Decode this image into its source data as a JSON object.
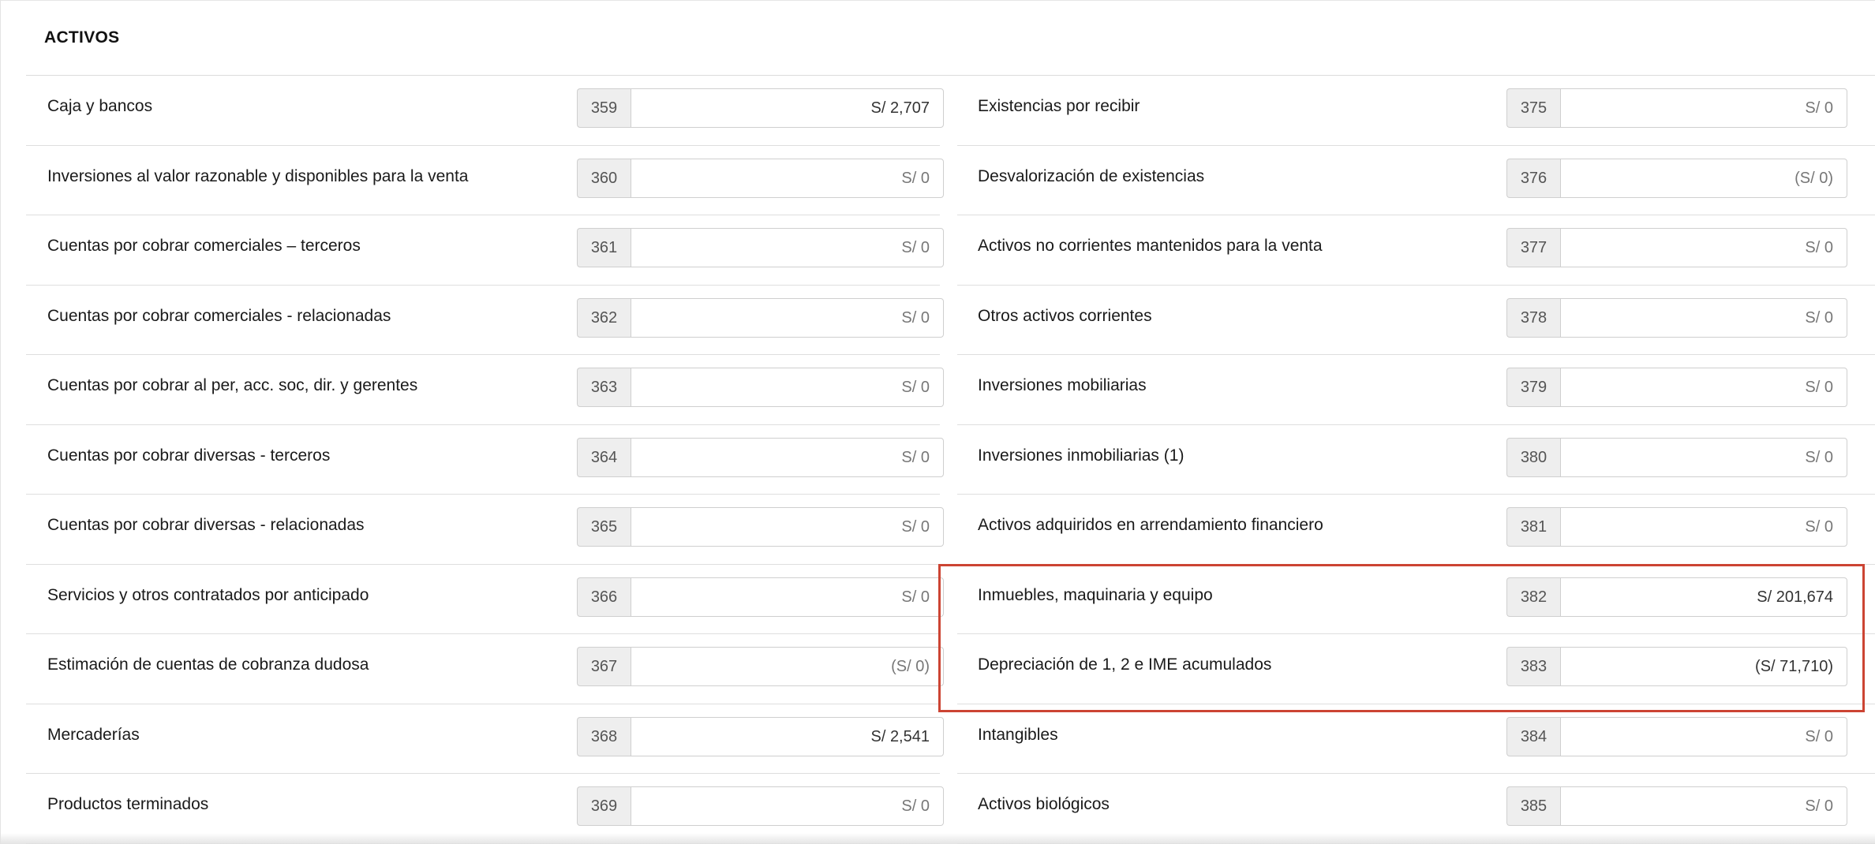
{
  "section": {
    "title": "ACTIVOS"
  },
  "left_rows": [
    {
      "label": "Caja y bancos",
      "code": "359",
      "value": "S/ 2,707"
    },
    {
      "label": "Inversiones al valor razonable y disponibles para la venta",
      "code": "360",
      "value": "S/ 0"
    },
    {
      "label": "Cuentas por cobrar comerciales – terceros",
      "code": "361",
      "value": "S/ 0"
    },
    {
      "label": "Cuentas por cobrar comerciales - relacionadas",
      "code": "362",
      "value": "S/ 0"
    },
    {
      "label": "Cuentas por cobrar al per, acc. soc, dir. y gerentes",
      "code": "363",
      "value": "S/ 0"
    },
    {
      "label": "Cuentas por cobrar diversas - terceros",
      "code": "364",
      "value": "S/ 0"
    },
    {
      "label": "Cuentas por cobrar diversas - relacionadas",
      "code": "365",
      "value": "S/ 0"
    },
    {
      "label": "Servicios y otros contratados por anticipado",
      "code": "366",
      "value": "S/ 0"
    },
    {
      "label": "Estimación de cuentas de cobranza dudosa",
      "code": "367",
      "value": "(S/ 0)"
    },
    {
      "label": "Mercaderías",
      "code": "368",
      "value": "S/ 2,541"
    },
    {
      "label": "Productos terminados",
      "code": "369",
      "value": "S/ 0"
    }
  ],
  "right_rows": [
    {
      "label": "Existencias por recibir",
      "code": "375",
      "value": "S/ 0"
    },
    {
      "label": "Desvalorización de existencias",
      "code": "376",
      "value": "(S/ 0)"
    },
    {
      "label": "Activos no corrientes mantenidos para la venta",
      "code": "377",
      "value": "S/ 0"
    },
    {
      "label": "Otros activos corrientes",
      "code": "378",
      "value": "S/ 0"
    },
    {
      "label": "Inversiones mobiliarias",
      "code": "379",
      "value": "S/ 0"
    },
    {
      "label": "Inversiones inmobiliarias (1)",
      "code": "380",
      "value": "S/ 0"
    },
    {
      "label": "Activos adquiridos en arrendamiento financiero",
      "code": "381",
      "value": "S/ 0"
    },
    {
      "label": "Inmuebles, maquinaria y equipo",
      "code": "382",
      "value": "S/ 201,674"
    },
    {
      "label": "Depreciación de 1, 2 e IME acumulados",
      "code": "383",
      "value": "(S/ 71,710)"
    },
    {
      "label": "Intangibles",
      "code": "384",
      "value": "S/ 0"
    },
    {
      "label": "Activos biológicos",
      "code": "385",
      "value": "S/ 0"
    }
  ],
  "colors": {
    "highlight_border": "#cc4433",
    "code_background": "#eeeeee",
    "row_divider": "#dedede"
  }
}
